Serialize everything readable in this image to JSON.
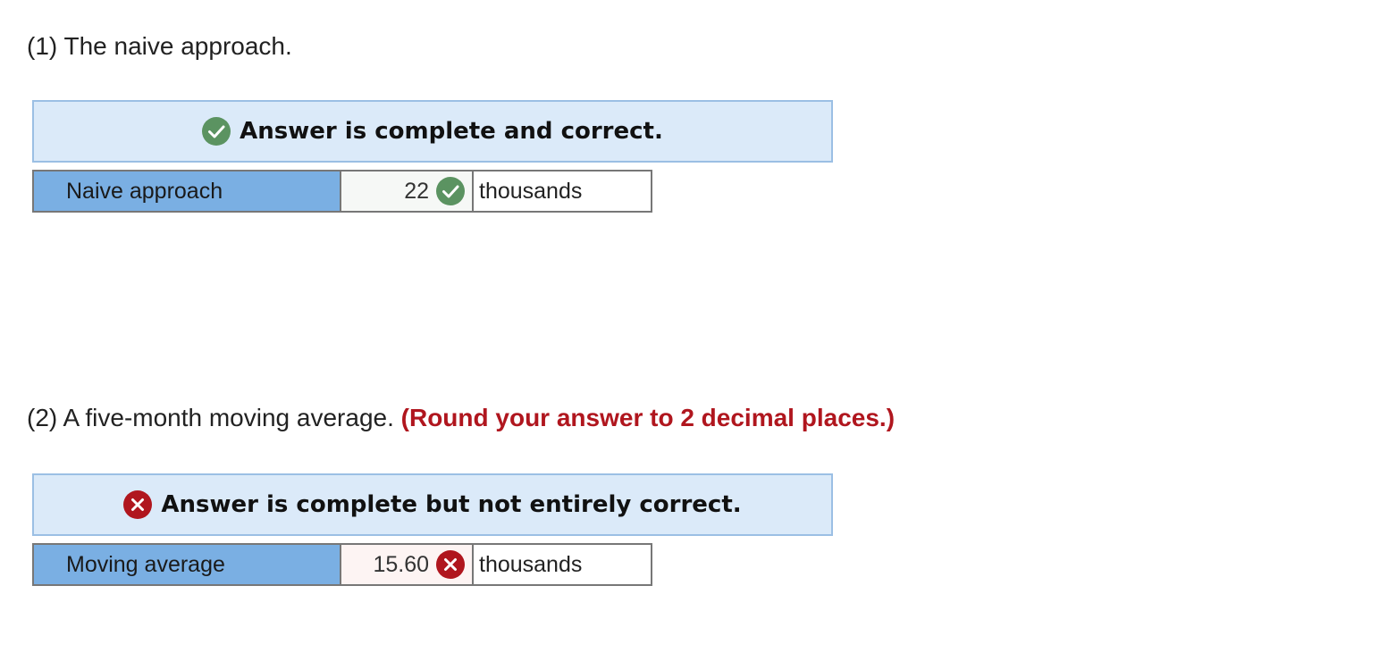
{
  "part1": {
    "question": "(1) The naive approach.",
    "banner": {
      "status": "correct",
      "icon": "check-circle-icon",
      "color": "#5b9361",
      "text": "Answer is complete and correct."
    },
    "row": {
      "label": "Naive approach",
      "value": "22",
      "result": "correct",
      "icon": "check-circle-icon",
      "unit": "thousands"
    }
  },
  "part2": {
    "question": "(2) A five-month moving average.",
    "note": "(Round your answer to 2 decimal places.)",
    "note_color": "#b0161e",
    "banner": {
      "status": "incorrect",
      "icon": "x-circle-icon",
      "color": "#b0161e",
      "text": "Answer is complete but not entirely correct."
    },
    "row": {
      "label": "Moving average",
      "value": "15.60",
      "result": "incorrect",
      "icon": "x-circle-icon",
      "unit": "thousands"
    }
  },
  "colors": {
    "banner_bg": "#dbeaf9",
    "label_bg": "#7aafe3",
    "correct": "#5b9361",
    "incorrect": "#b0161e"
  }
}
